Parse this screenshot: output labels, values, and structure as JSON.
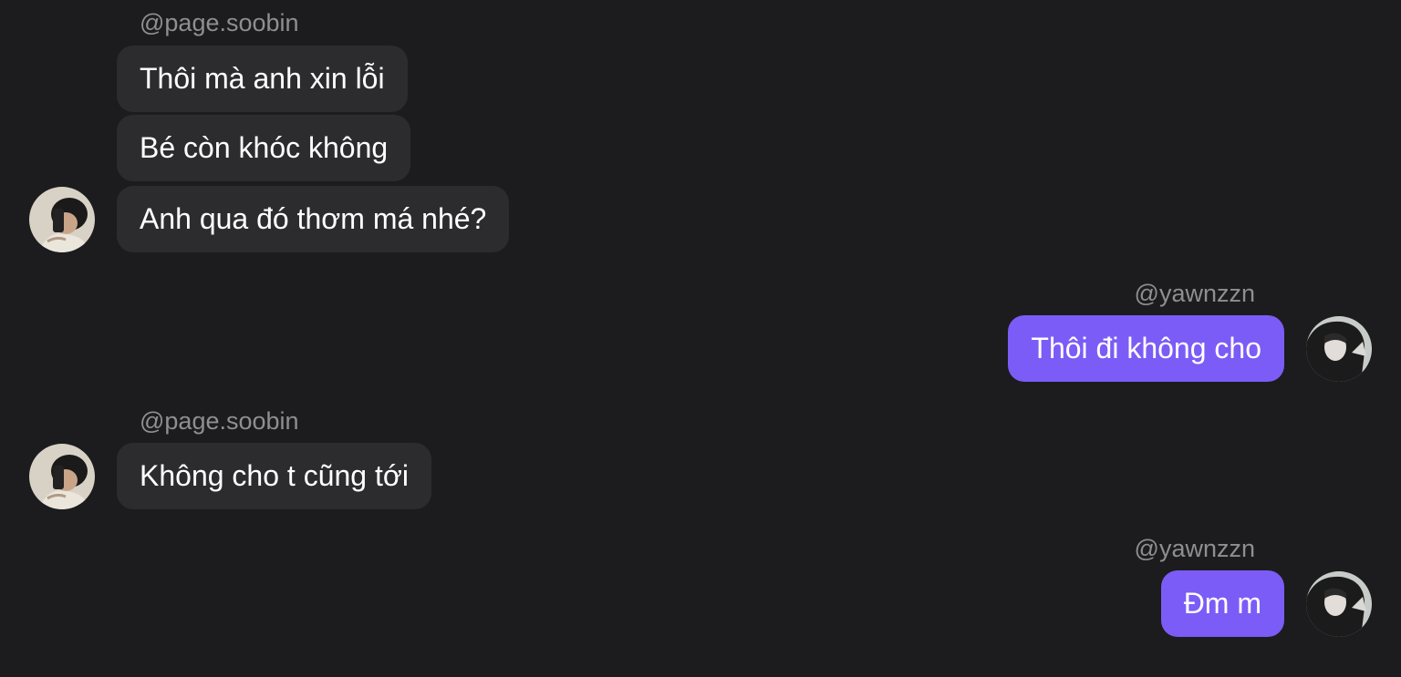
{
  "colors": {
    "background": "#1c1c1e",
    "incoming_bubble": "#2c2c2e",
    "outgoing_bubble": "#7b5cf6",
    "username": "#8e8e93",
    "text": "#ffffff"
  },
  "groups": [
    {
      "sender": "@page.soobin",
      "direction": "incoming",
      "messages": [
        "Thôi mà anh xin lỗi",
        "Bé còn khóc không",
        "Anh qua đó thơm má nhé?"
      ]
    },
    {
      "sender": "@yawnzzn",
      "direction": "outgoing",
      "messages": [
        "Thôi đi không cho"
      ]
    },
    {
      "sender": "@page.soobin",
      "direction": "incoming",
      "messages": [
        "Không cho t cũng tới"
      ]
    },
    {
      "sender": "@yawnzzn",
      "direction": "outgoing",
      "messages": [
        "Đm m"
      ]
    }
  ]
}
